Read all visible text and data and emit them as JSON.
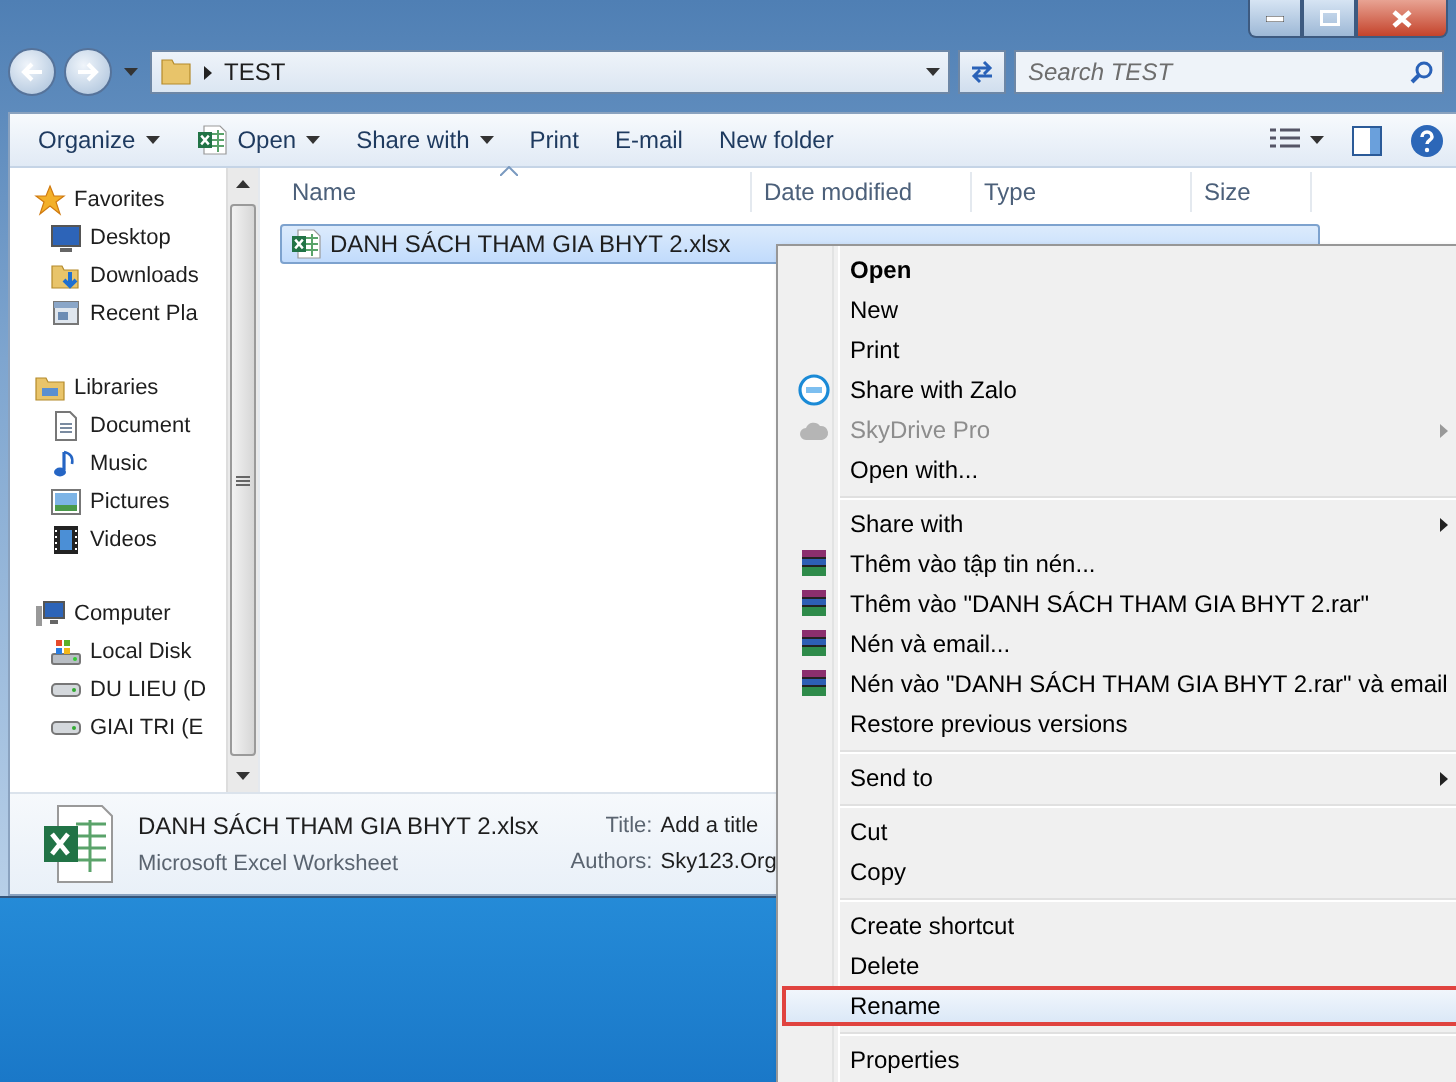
{
  "address": {
    "path": "TEST"
  },
  "search": {
    "placeholder": "Search TEST"
  },
  "toolbar": [
    {
      "label": "Organize",
      "kind": "plain",
      "dropdown": true
    },
    {
      "label": "Open",
      "kind": "spreadsheet",
      "dropdown": true
    },
    {
      "label": "Share with",
      "kind": "plain",
      "dropdown": true
    },
    {
      "label": "Print",
      "kind": "plain",
      "dropdown": false
    },
    {
      "label": "E-mail",
      "kind": "plain",
      "dropdown": false
    },
    {
      "label": "New folder",
      "kind": "plain",
      "dropdown": false
    }
  ],
  "nav_pane": [
    {
      "label": "Favorites",
      "kind": "star",
      "children": [
        {
          "label": "Desktop",
          "kind": "desktop"
        },
        {
          "label": "Downloads",
          "kind": "downloads"
        },
        {
          "label": "Recent Pla",
          "kind": "recent"
        }
      ]
    },
    {
      "label": "Libraries",
      "kind": "libraries",
      "children": [
        {
          "label": "Document",
          "kind": "document"
        },
        {
          "label": "Music",
          "kind": "music"
        },
        {
          "label": "Pictures",
          "kind": "pictures"
        },
        {
          "label": "Videos",
          "kind": "videos"
        }
      ]
    },
    {
      "label": "Computer",
      "kind": "computer",
      "children": [
        {
          "label": "Local Disk",
          "kind": "disk"
        },
        {
          "label": "DU LIEU (D",
          "kind": "drive"
        },
        {
          "label": "GIAI TRI (E",
          "kind": "drive"
        }
      ]
    }
  ],
  "columns": [
    {
      "label": "Name",
      "sorted": true
    },
    {
      "label": "Date modified",
      "sorted": false
    },
    {
      "label": "Type",
      "sorted": false
    },
    {
      "label": "Size",
      "sorted": false
    }
  ],
  "files": [
    {
      "name": "DANH SÁCH THAM GIA BHYT 2.xlsx",
      "selected": true
    }
  ],
  "details": {
    "name": "DANH SÁCH THAM GIA BHYT 2.xlsx",
    "type": "Microsoft Excel Worksheet",
    "title_label": "Title:",
    "title_value": "Add a title",
    "authors_label": "Authors:",
    "authors_value": "Sky123.Org"
  },
  "menu": {
    "items": [
      {
        "kind": "plain",
        "label": "Open",
        "bold": true,
        "disabled": false,
        "submenu": false,
        "selected": false
      },
      {
        "kind": "plain",
        "label": "New",
        "bold": false,
        "disabled": false,
        "submenu": false,
        "selected": false
      },
      {
        "kind": "plain",
        "label": "Print",
        "bold": false,
        "disabled": false,
        "submenu": false,
        "selected": false
      },
      {
        "kind": "zalo",
        "label": "Share with Zalo",
        "bold": false,
        "disabled": false,
        "submenu": false,
        "selected": false
      },
      {
        "kind": "cloud",
        "label": "SkyDrive Pro",
        "bold": false,
        "disabled": true,
        "submenu": true,
        "selected": false
      },
      {
        "kind": "plain",
        "label": "Open with...",
        "bold": false,
        "disabled": false,
        "submenu": false,
        "selected": false
      },
      {
        "kind": "separator"
      },
      {
        "kind": "plain",
        "label": "Share with",
        "bold": false,
        "disabled": false,
        "submenu": true,
        "selected": false
      },
      {
        "kind": "archive",
        "label": "Thêm vào tập tin nén...",
        "bold": false,
        "disabled": false,
        "submenu": false,
        "selected": false
      },
      {
        "kind": "archive",
        "label": "Thêm vào \"DANH SÁCH THAM GIA BHYT 2.rar\"",
        "bold": false,
        "disabled": false,
        "submenu": false,
        "selected": false
      },
      {
        "kind": "archive",
        "label": "Nén và email...",
        "bold": false,
        "disabled": false,
        "submenu": false,
        "selected": false
      },
      {
        "kind": "archive",
        "label": "Nén vào \"DANH SÁCH THAM GIA BHYT 2.rar\" và email",
        "bold": false,
        "disabled": false,
        "submenu": false,
        "selected": false
      },
      {
        "kind": "plain",
        "label": "Restore previous versions",
        "bold": false,
        "disabled": false,
        "submenu": false,
        "selected": false
      },
      {
        "kind": "separator"
      },
      {
        "kind": "plain",
        "label": "Send to",
        "bold": false,
        "disabled": false,
        "submenu": true,
        "selected": false
      },
      {
        "kind": "separator"
      },
      {
        "kind": "plain",
        "label": "Cut",
        "bold": false,
        "disabled": false,
        "submenu": false,
        "selected": false
      },
      {
        "kind": "plain",
        "label": "Copy",
        "bold": false,
        "disabled": false,
        "submenu": false,
        "selected": false
      },
      {
        "kind": "separator"
      },
      {
        "kind": "plain",
        "label": "Create shortcut",
        "bold": false,
        "disabled": false,
        "submenu": false,
        "selected": false
      },
      {
        "kind": "plain",
        "label": "Delete",
        "bold": false,
        "disabled": false,
        "submenu": false,
        "selected": false
      },
      {
        "kind": "plain",
        "label": "Rename",
        "bold": false,
        "disabled": false,
        "submenu": false,
        "selected": true
      },
      {
        "kind": "separator"
      },
      {
        "kind": "plain",
        "label": "Properties",
        "bold": false,
        "disabled": false,
        "submenu": false,
        "selected": false
      }
    ]
  }
}
